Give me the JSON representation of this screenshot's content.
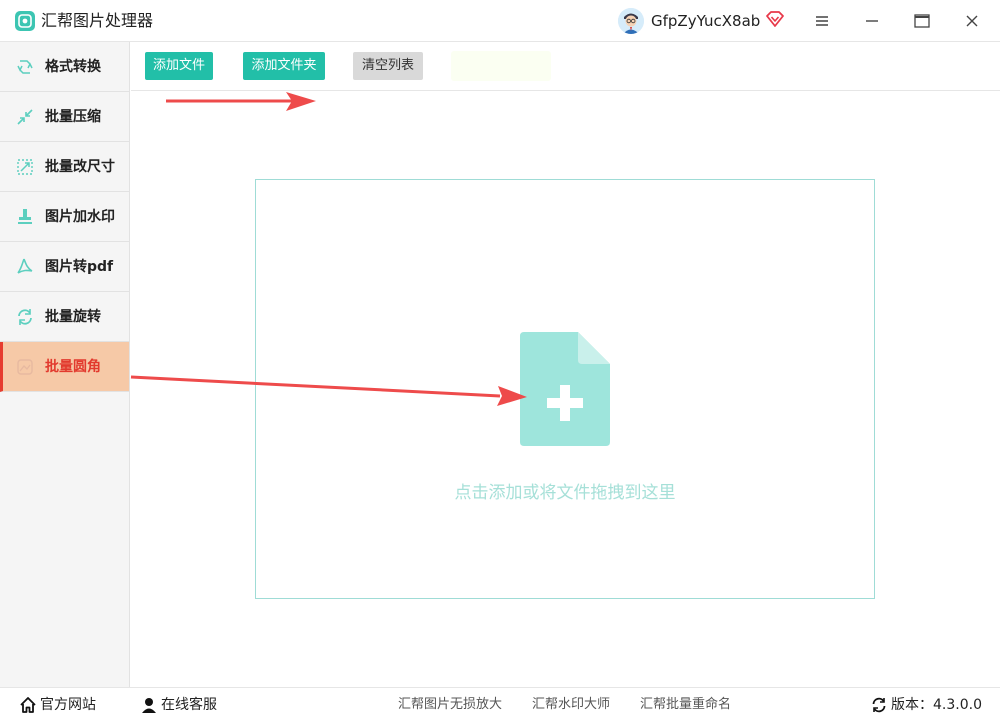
{
  "app": {
    "title": "汇帮图片处理器"
  },
  "user": {
    "name": "GfpZyYucX8ab"
  },
  "sidebar": {
    "items": [
      {
        "label": "格式转换",
        "icon": "format-convert-icon"
      },
      {
        "label": "批量压缩",
        "icon": "compress-icon"
      },
      {
        "label": "批量改尺寸",
        "icon": "resize-icon"
      },
      {
        "label": "图片加水印",
        "icon": "watermark-icon"
      },
      {
        "label": "图片转pdf",
        "icon": "pdf-icon"
      },
      {
        "label": "批量旋转",
        "icon": "rotate-icon"
      },
      {
        "label": "批量圆角",
        "icon": "rounded-corner-icon",
        "active": true
      }
    ]
  },
  "toolbar": {
    "add_file": "添加文件",
    "add_folder": "添加文件夹",
    "clear_list": "清空列表"
  },
  "dropzone": {
    "hint": "点击添加或将文件拖拽到这里"
  },
  "footer": {
    "official_site": "官方网站",
    "online_service": "在线客服",
    "links": [
      "汇帮图片无损放大",
      "汇帮水印大师",
      "汇帮批量重命名"
    ],
    "version_label": "版本：",
    "version": "4.3.0.0"
  },
  "colors": {
    "accent": "#22bfa8",
    "active_bg": "#f6c9a7",
    "active_text": "#e23a2e",
    "annotation_arrow": "#ee4b4b"
  }
}
